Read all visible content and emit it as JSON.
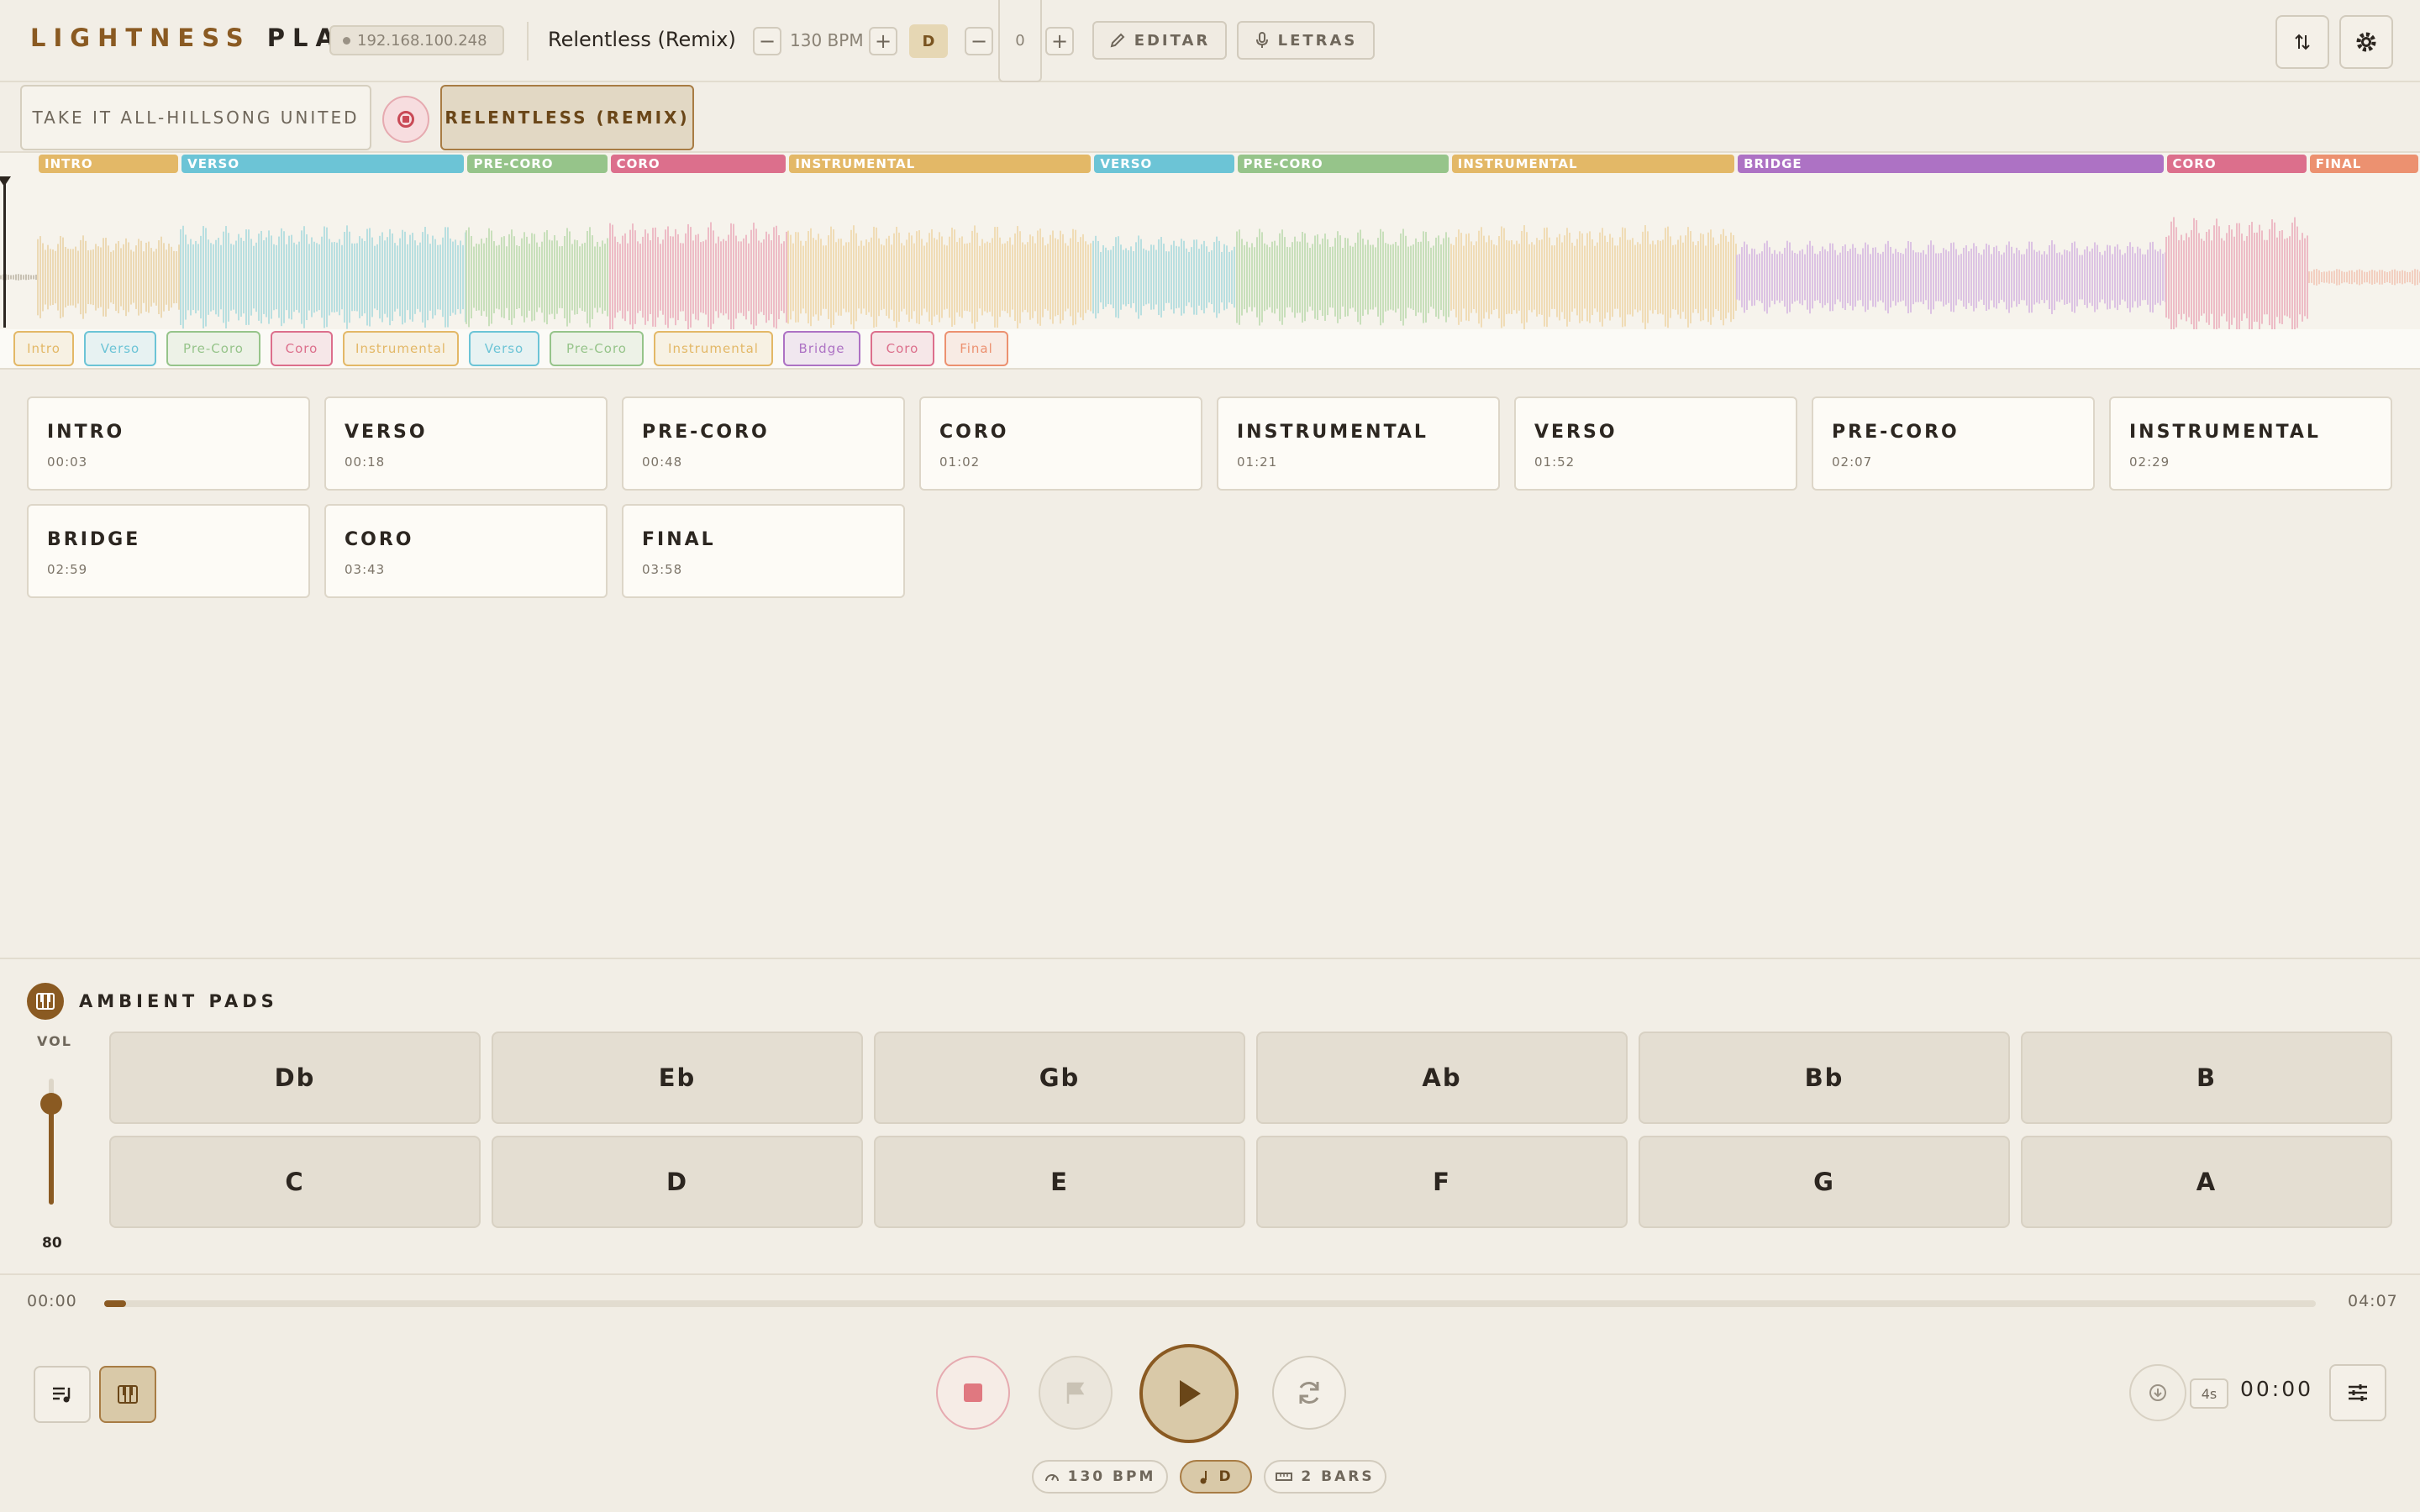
{
  "app": {
    "logo_part1": "LIGHTNESS",
    "logo_part2": "PLAY",
    "ip": "192.168.100.248"
  },
  "song": {
    "title": "Relentless (Remix)",
    "bpm_label": "130 BPM",
    "key": "D",
    "transpose": "0"
  },
  "toolbar": {
    "edit_label": "EDITAR",
    "lyrics_label": "LETRAS"
  },
  "setlist": [
    {
      "label": "TAKE IT ALL-HILLSONG UNITED",
      "active": false
    },
    {
      "label": "RELENTLESS (REMIX)",
      "active": true
    }
  ],
  "waveform": {
    "segments": [
      {
        "label": "INTRO",
        "color": "#e3b867",
        "wave": "#ecd9b4",
        "start": 0.0,
        "end": 0.06
      },
      {
        "label": "VERSO",
        "color": "#6cc4d6",
        "wave": "#b9dfe0",
        "start": 0.06,
        "end": 0.18
      },
      {
        "label": "PRE-CORO",
        "color": "#96c48a",
        "wave": "#c8dfbb",
        "start": 0.18,
        "end": 0.24
      },
      {
        "label": "CORO",
        "color": "#dc6f8c",
        "wave": "#edbcc6",
        "start": 0.24,
        "end": 0.315
      },
      {
        "label": "INSTRUMENTAL",
        "color": "#e3b867",
        "wave": "#f0dcb6",
        "start": 0.315,
        "end": 0.443
      },
      {
        "label": "VERSO",
        "color": "#6cc4d6",
        "wave": "#b9dfe0",
        "start": 0.443,
        "end": 0.503
      },
      {
        "label": "PRE-CORO",
        "color": "#96c48a",
        "wave": "#c8dfbb",
        "start": 0.503,
        "end": 0.593
      },
      {
        "label": "INSTRUMENTAL",
        "color": "#e3b867",
        "wave": "#f0dcb6",
        "start": 0.593,
        "end": 0.713
      },
      {
        "label": "BRIDGE",
        "color": "#ad72c4",
        "wave": "#dcc3e3",
        "start": 0.713,
        "end": 0.893
      },
      {
        "label": "CORO",
        "color": "#dc6f8c",
        "wave": "#edbcc6",
        "start": 0.893,
        "end": 0.953
      },
      {
        "label": "FINAL",
        "color": "#ec9170",
        "wave": "#f2cfc0",
        "start": 0.953,
        "end": 1.0
      }
    ]
  },
  "chips": [
    {
      "label": "Intro",
      "color": "#e3b867"
    },
    {
      "label": "Verso",
      "color": "#6cc4d6"
    },
    {
      "label": "Pre-Coro",
      "color": "#96c48a"
    },
    {
      "label": "Coro",
      "color": "#dc6f8c"
    },
    {
      "label": "Instrumental",
      "color": "#e3b867"
    },
    {
      "label": "Verso",
      "color": "#6cc4d6"
    },
    {
      "label": "Pre-Coro",
      "color": "#96c48a"
    },
    {
      "label": "Instrumental",
      "color": "#e3b867"
    },
    {
      "label": "Bridge",
      "color": "#ad72c4"
    },
    {
      "label": "Coro",
      "color": "#dc6f8c"
    },
    {
      "label": "Final",
      "color": "#ec9170"
    }
  ],
  "sections": [
    {
      "name": "INTRO",
      "time": "00:03"
    },
    {
      "name": "VERSO",
      "time": "00:18"
    },
    {
      "name": "PRE-CORO",
      "time": "00:48"
    },
    {
      "name": "CORO",
      "time": "01:02"
    },
    {
      "name": "INSTRUMENTAL",
      "time": "01:21"
    },
    {
      "name": "VERSO",
      "time": "01:52"
    },
    {
      "name": "PRE-CORO",
      "time": "02:07"
    },
    {
      "name": "INSTRUMENTAL",
      "time": "02:29"
    },
    {
      "name": "BRIDGE",
      "time": "02:59"
    },
    {
      "name": "CORO",
      "time": "03:43"
    },
    {
      "name": "FINAL",
      "time": "03:58"
    }
  ],
  "pads": {
    "title": "AMBIENT PADS",
    "vol_label": "VOL",
    "volume": "80",
    "row1": [
      "Db",
      "Eb",
      "Gb",
      "Ab",
      "Bb",
      "B"
    ],
    "row2": [
      "C",
      "D",
      "E",
      "F",
      "G",
      "A"
    ]
  },
  "transport": {
    "current": "00:00",
    "total": "04:07",
    "progress": 0.01,
    "counter": "00:00",
    "countin": "4s",
    "bpm_pill": "130 BPM",
    "key_pill": "D",
    "bars_pill": "2 BARS"
  },
  "icons": [
    "pencil-icon",
    "mic-icon",
    "sort-icon",
    "gear-icon",
    "record-icon",
    "piano-icon",
    "playlist-icon",
    "stop-icon",
    "flag-icon",
    "play-icon",
    "loop-icon",
    "download-icon",
    "sliders-icon",
    "gauge-icon",
    "note-icon",
    "ruler-icon"
  ]
}
